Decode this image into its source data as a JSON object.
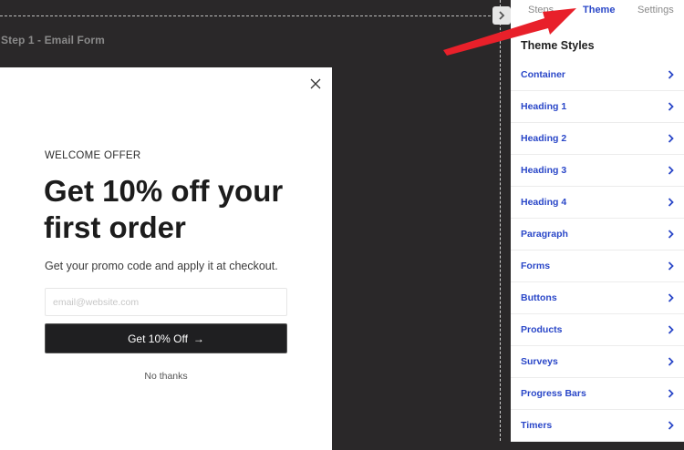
{
  "canvas": {
    "step_label": "Step 1 - Email Form"
  },
  "modal": {
    "kicker": "WELCOME OFFER",
    "headline": "Get 10% off your first order",
    "subtext": "Get your promo code and apply it at checkout.",
    "email_placeholder": "email@website.com",
    "cta_label": "Get 10% Off",
    "cta_arrow": "→",
    "dismiss_label": "No thanks"
  },
  "panel": {
    "tabs": [
      {
        "label": "Steps",
        "active": false
      },
      {
        "label": "Theme",
        "active": true
      },
      {
        "label": "Settings",
        "active": false
      }
    ],
    "title": "Theme Styles",
    "items": [
      {
        "label": "Container"
      },
      {
        "label": "Heading 1"
      },
      {
        "label": "Heading 2"
      },
      {
        "label": "Heading 3"
      },
      {
        "label": "Heading 4"
      },
      {
        "label": "Paragraph"
      },
      {
        "label": "Forms"
      },
      {
        "label": "Buttons"
      },
      {
        "label": "Products"
      },
      {
        "label": "Surveys"
      },
      {
        "label": "Progress Bars"
      },
      {
        "label": "Timers"
      }
    ]
  },
  "icons": {
    "collapse": "chevron-right-icon",
    "close": "close-icon",
    "item_chevron": "chevron-right-icon"
  },
  "colors": {
    "canvas_bg": "#2a2829",
    "accent_blue": "#2a47c8",
    "annotation_red": "#e8202a",
    "button_dark": "#1f1f21"
  }
}
